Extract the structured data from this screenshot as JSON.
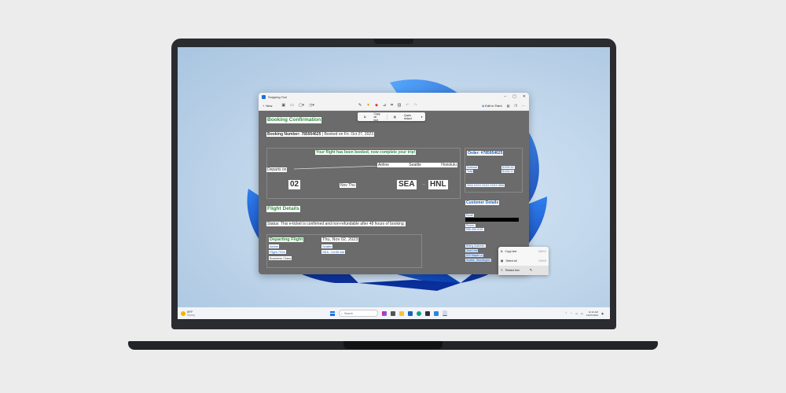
{
  "window": {
    "title": "Snipping Tool",
    "controls": [
      "–",
      "▢",
      "✕"
    ],
    "new_label": "New",
    "edit_in_paint": "Edit in Paint"
  },
  "action_bar": {
    "copy_all_text": "Copy all text",
    "quick_redact": "Quick redact"
  },
  "booking": {
    "heading": "Booking Confirmation",
    "number_label": "Booking Number: 785954625",
    "booked_on": "Booked on Fri. Oct 27, 2023",
    "banner": "Your flight has been booked, now complete your trip!",
    "departs_on": "Departs on",
    "airline": "Airline",
    "seattle": "Seattle",
    "honolulu": "Honolulu",
    "date_num": "02",
    "date_text": "Nov Thu",
    "from_code": "SEA",
    "to_code": "HNL"
  },
  "order": {
    "title": "Order: #785954625",
    "subtotal_label": "Subtotal",
    "subtotal_value": "$1000.00",
    "total_label": "Total",
    "total_value": "$1332.11",
    "card": "VISA XXXX XXXX XXXX 3564"
  },
  "flight_details": {
    "heading": "Flight Details",
    "status": "Status: This e-ticket is confirmed and non-refundable after 48 hours of booking.",
    "departing_flight": "Departing Flight",
    "airline": "Airline",
    "flight_no": "Flight 7934",
    "class": "Business Class",
    "date": "Thu, Nov 02, 2023",
    "city": "Seattle",
    "time": "SEA - 04:55 AM"
  },
  "customer": {
    "heading": "Customer Details",
    "email_label": "Email",
    "phone_label": "Phone:",
    "phone": "555-459-0101",
    "billing_label": "Billing Address:",
    "name": "Jiran Lee",
    "street": "523 Maple Ln",
    "city": "Seattle, Washington"
  },
  "context_menu": {
    "copy_text": "Copy text",
    "copy_text_sc": "Ctrl+C",
    "select_all": "Select all",
    "select_all_sc": "Ctrl+A",
    "redact_text": "Redact text"
  },
  "taskbar": {
    "temp": "59°F",
    "weather": "Sunny",
    "search_placeholder": "Search",
    "time": "11:11 AM",
    "date": "10/27/2023"
  },
  "colors": {
    "accent": "#1a73e8",
    "highlight_green": "#2e8b3e",
    "highlight_blue": "#1a5bb5"
  }
}
